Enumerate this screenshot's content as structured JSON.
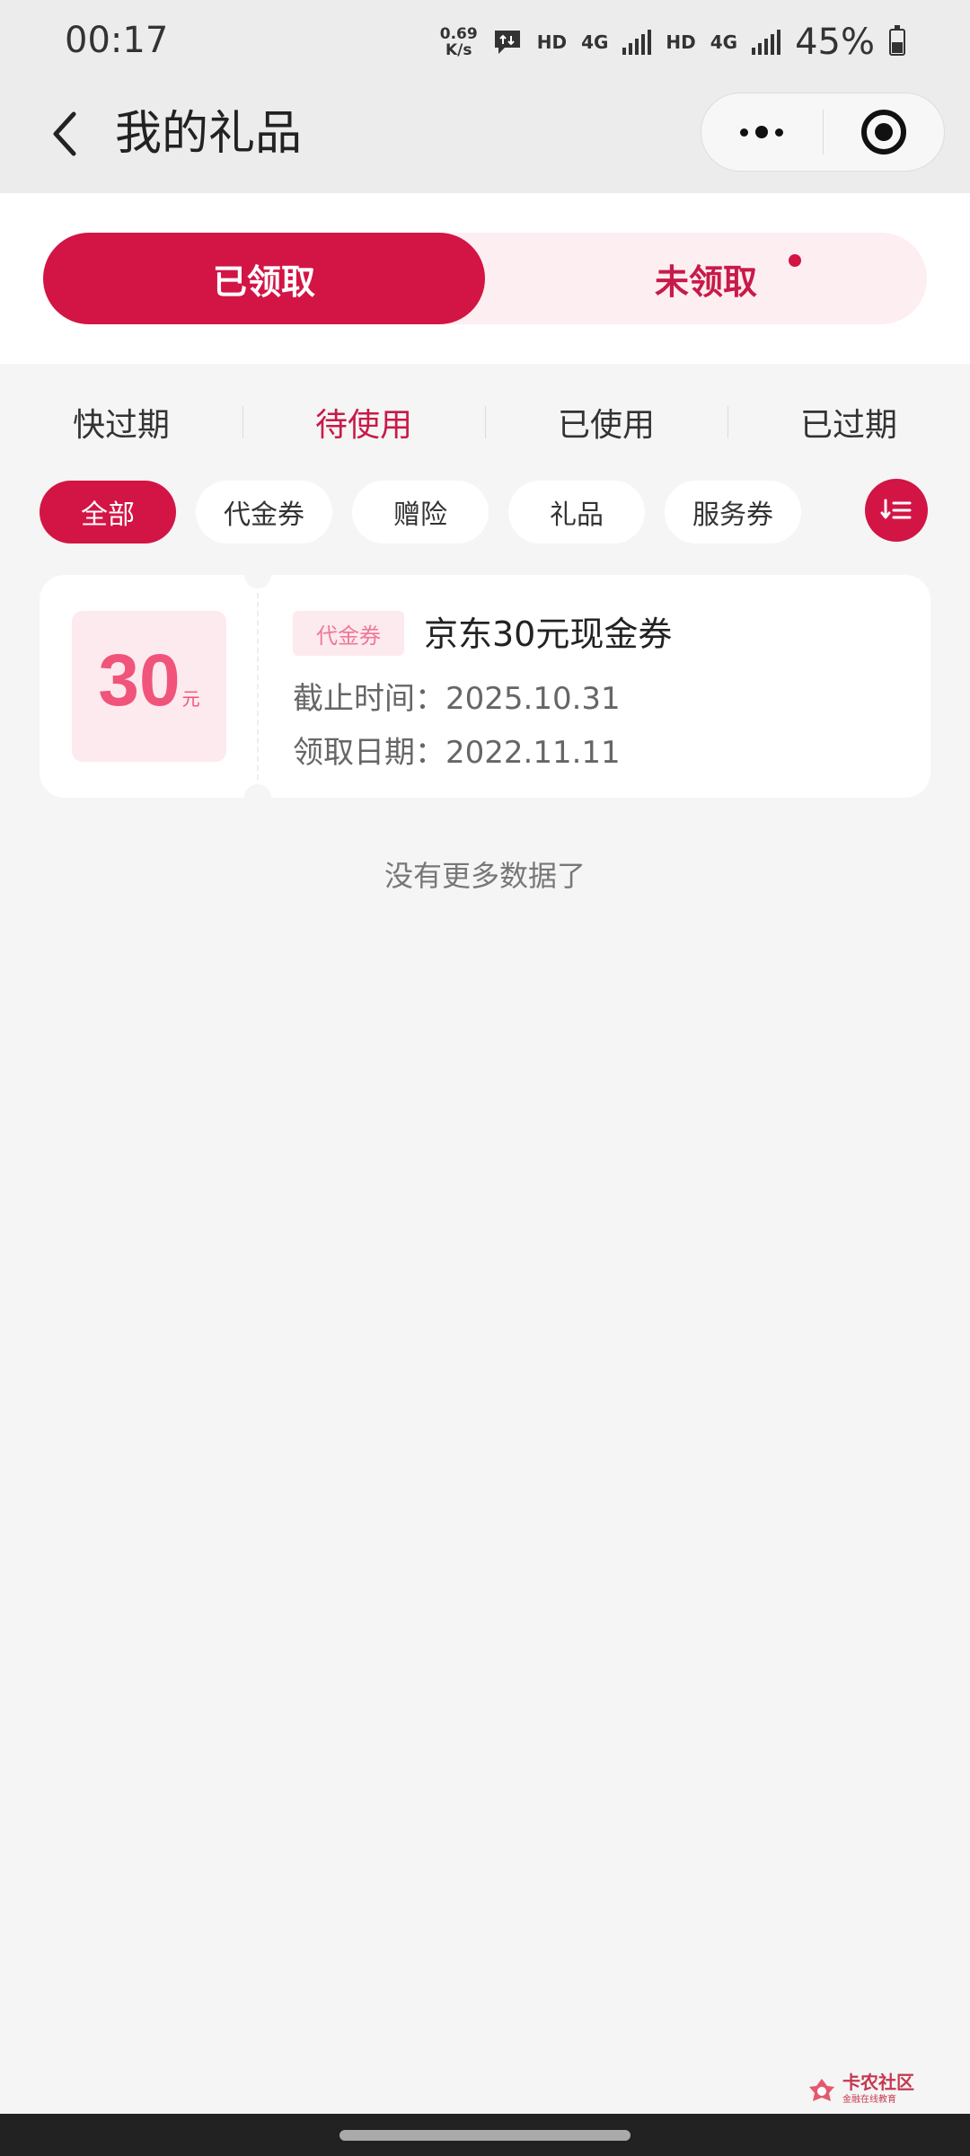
{
  "status_bar": {
    "time": "00:17",
    "net_speed_value": "0.69",
    "net_speed_unit": "K/s",
    "hd1": "HD",
    "net1": "4G",
    "hd2": "HD",
    "net2": "4G",
    "battery": "45%",
    "battery_level": 0.45
  },
  "nav": {
    "title": "我的礼品"
  },
  "segments": {
    "received": "已领取",
    "unreceived": "未领取"
  },
  "status_tabs": [
    "快过期",
    "待使用",
    "已使用",
    "已过期"
  ],
  "active_status_tab": "待使用",
  "chips": [
    "全部",
    "代金券",
    "赠险",
    "礼品",
    "服务券"
  ],
  "active_chip": "全部",
  "coupon": {
    "amount": "30",
    "unit": "元",
    "tag": "代金券",
    "title": "京东30元现金券",
    "deadline": "截止时间：2025.10.31",
    "received_date": "领取日期：2022.11.11"
  },
  "footer_text": "没有更多数据了",
  "watermark": {
    "main": "卡农社区",
    "sub": "金融在线教育"
  },
  "colors": {
    "accent": "#d21545",
    "accent_light": "#fdeef1",
    "amount": "#f0547a"
  }
}
